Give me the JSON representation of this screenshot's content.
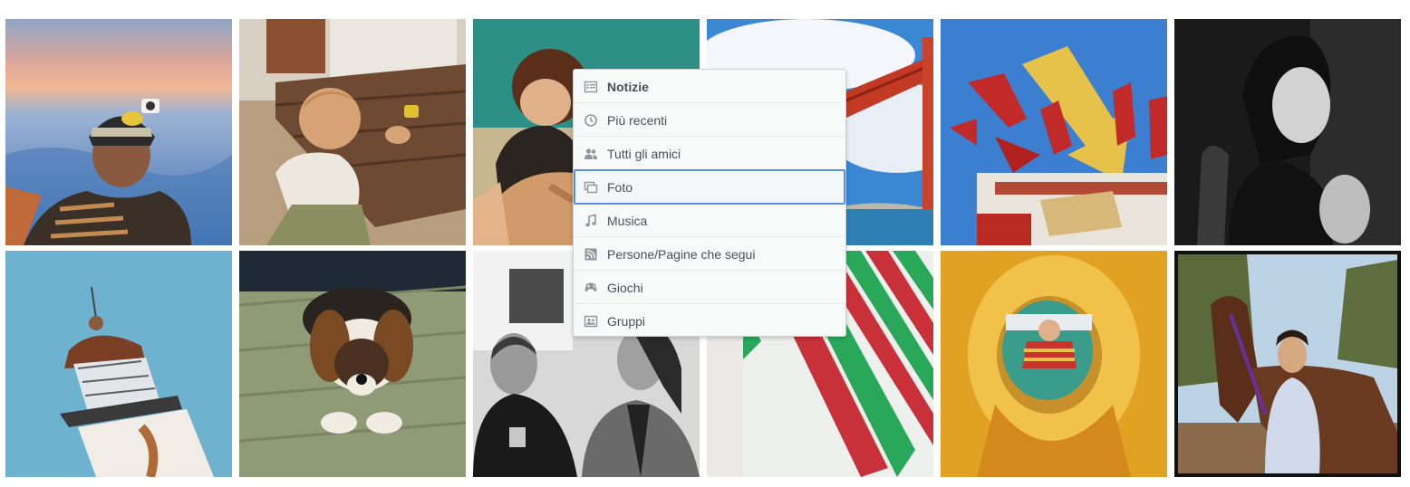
{
  "photos": [
    {
      "label": "mountain-hiker-photo",
      "row": 1,
      "col": 1
    },
    {
      "label": "toddler-outdoors-photo",
      "row": 1,
      "col": 2
    },
    {
      "label": "child-on-sand-photo",
      "row": 1,
      "col": 3
    },
    {
      "label": "bridge-sky-photo",
      "row": 1,
      "col": 4
    },
    {
      "label": "neon-sign-photo",
      "row": 1,
      "col": 5
    },
    {
      "label": "woman-portrait-bw-photo",
      "row": 1,
      "col": 6
    },
    {
      "label": "lighthouse-photo",
      "row": 2,
      "col": 1
    },
    {
      "label": "puppy-photo",
      "row": 2,
      "col": 2
    },
    {
      "label": "two-men-bw-photo",
      "row": 2,
      "col": 3
    },
    {
      "label": "striped-art-photo",
      "row": 2,
      "col": 4
    },
    {
      "label": "child-in-slide-photo",
      "row": 2,
      "col": 5
    },
    {
      "label": "woman-with-horse-photo",
      "row": 2,
      "col": 6
    }
  ],
  "menu": {
    "items": [
      {
        "label": "Notizie",
        "icon": "news-feed-icon"
      },
      {
        "label": "Più recenti",
        "icon": "clock-icon"
      },
      {
        "label": "Tutti gli amici",
        "icon": "friends-icon"
      },
      {
        "label": "Foto",
        "icon": "photos-icon"
      },
      {
        "label": "Musica",
        "icon": "music-note-icon"
      },
      {
        "label": "Persone/Pagine che segui",
        "icon": "rss-feed-icon"
      },
      {
        "label": "Giochi",
        "icon": "gamepad-icon"
      },
      {
        "label": "Gruppi",
        "icon": "groups-icon"
      }
    ],
    "selected_index": 0,
    "focused_index": 3
  },
  "colors": {
    "focus_border": "#5b8fe0",
    "menu_background": "#f8f9f9",
    "menu_text": "#4b4f56",
    "icon_color": "#90949c"
  }
}
